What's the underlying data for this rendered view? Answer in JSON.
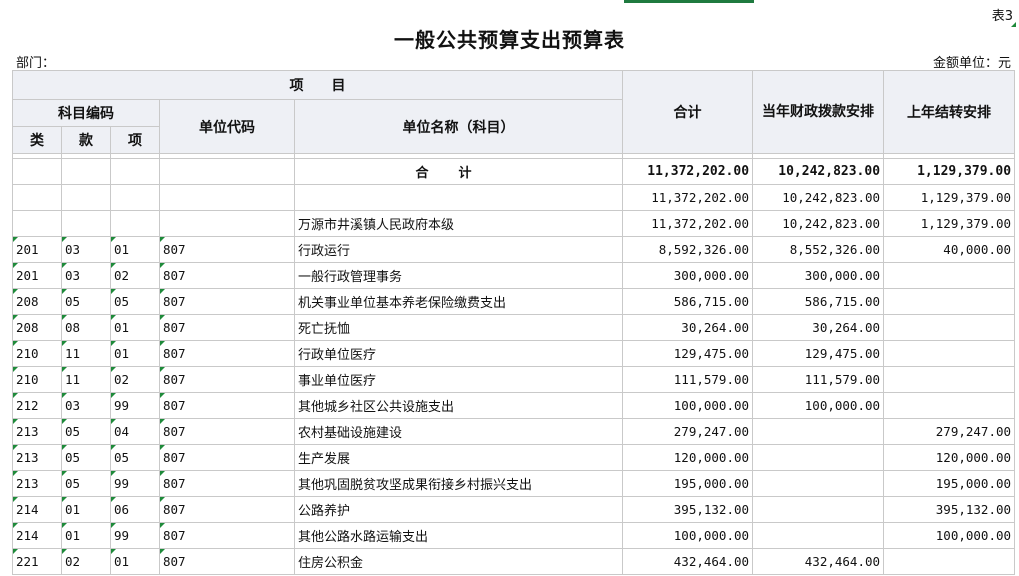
{
  "sheet_no": "表3",
  "title": "一般公共预算支出预算表",
  "dept_label": "部门：",
  "unit_label": "金额单位：元",
  "headers": {
    "item": "项　　目",
    "subject_code": "科目编码",
    "lei": "类",
    "kuan": "款",
    "xiang": "项",
    "unit_code": "单位代码",
    "unit_name": "单位名称（科目）",
    "total": "合计",
    "current_year": "当年财政拨款安排",
    "last_year": "上年结转安排"
  },
  "total_row": {
    "label": "合计",
    "total": "11,372,202.00",
    "current": "10,242,823.00",
    "last": "1,129,379.00"
  },
  "subtotal_row": {
    "total": "11,372,202.00",
    "current": "10,242,823.00",
    "last": "1,129,379.00"
  },
  "org_row": {
    "name": "万源市井溪镇人民政府本级",
    "total": "11,372,202.00",
    "current": "10,242,823.00",
    "last": "1,129,379.00"
  },
  "rows": [
    {
      "lei": "201",
      "kuan": "03",
      "xiang": "01",
      "unit": "807",
      "name": "行政运行",
      "total": "8,592,326.00",
      "current": "8,552,326.00",
      "last": "40,000.00"
    },
    {
      "lei": "201",
      "kuan": "03",
      "xiang": "02",
      "unit": "807",
      "name": "一般行政管理事务",
      "total": "300,000.00",
      "current": "300,000.00",
      "last": ""
    },
    {
      "lei": "208",
      "kuan": "05",
      "xiang": "05",
      "unit": "807",
      "name": "机关事业单位基本养老保险缴费支出",
      "total": "586,715.00",
      "current": "586,715.00",
      "last": ""
    },
    {
      "lei": "208",
      "kuan": "08",
      "xiang": "01",
      "unit": "807",
      "name": "死亡抚恤",
      "total": "30,264.00",
      "current": "30,264.00",
      "last": ""
    },
    {
      "lei": "210",
      "kuan": "11",
      "xiang": "01",
      "unit": "807",
      "name": "行政单位医疗",
      "total": "129,475.00",
      "current": "129,475.00",
      "last": ""
    },
    {
      "lei": "210",
      "kuan": "11",
      "xiang": "02",
      "unit": "807",
      "name": "事业单位医疗",
      "total": "111,579.00",
      "current": "111,579.00",
      "last": ""
    },
    {
      "lei": "212",
      "kuan": "03",
      "xiang": "99",
      "unit": "807",
      "name": "其他城乡社区公共设施支出",
      "total": "100,000.00",
      "current": "100,000.00",
      "last": ""
    },
    {
      "lei": "213",
      "kuan": "05",
      "xiang": "04",
      "unit": "807",
      "name": "农村基础设施建设",
      "total": "279,247.00",
      "current": "",
      "last": "279,247.00"
    },
    {
      "lei": "213",
      "kuan": "05",
      "xiang": "05",
      "unit": "807",
      "name": "生产发展",
      "total": "120,000.00",
      "current": "",
      "last": "120,000.00"
    },
    {
      "lei": "213",
      "kuan": "05",
      "xiang": "99",
      "unit": "807",
      "name": "其他巩固脱贫攻坚成果衔接乡村振兴支出",
      "total": "195,000.00",
      "current": "",
      "last": "195,000.00"
    },
    {
      "lei": "214",
      "kuan": "01",
      "xiang": "06",
      "unit": "807",
      "name": "公路养护",
      "total": "395,132.00",
      "current": "",
      "last": "395,132.00"
    },
    {
      "lei": "214",
      "kuan": "01",
      "xiang": "99",
      "unit": "807",
      "name": "其他公路水路运输支出",
      "total": "100,000.00",
      "current": "",
      "last": "100,000.00"
    },
    {
      "lei": "221",
      "kuan": "02",
      "xiang": "01",
      "unit": "807",
      "name": "住房公积金",
      "total": "432,464.00",
      "current": "432,464.00",
      "last": ""
    }
  ]
}
